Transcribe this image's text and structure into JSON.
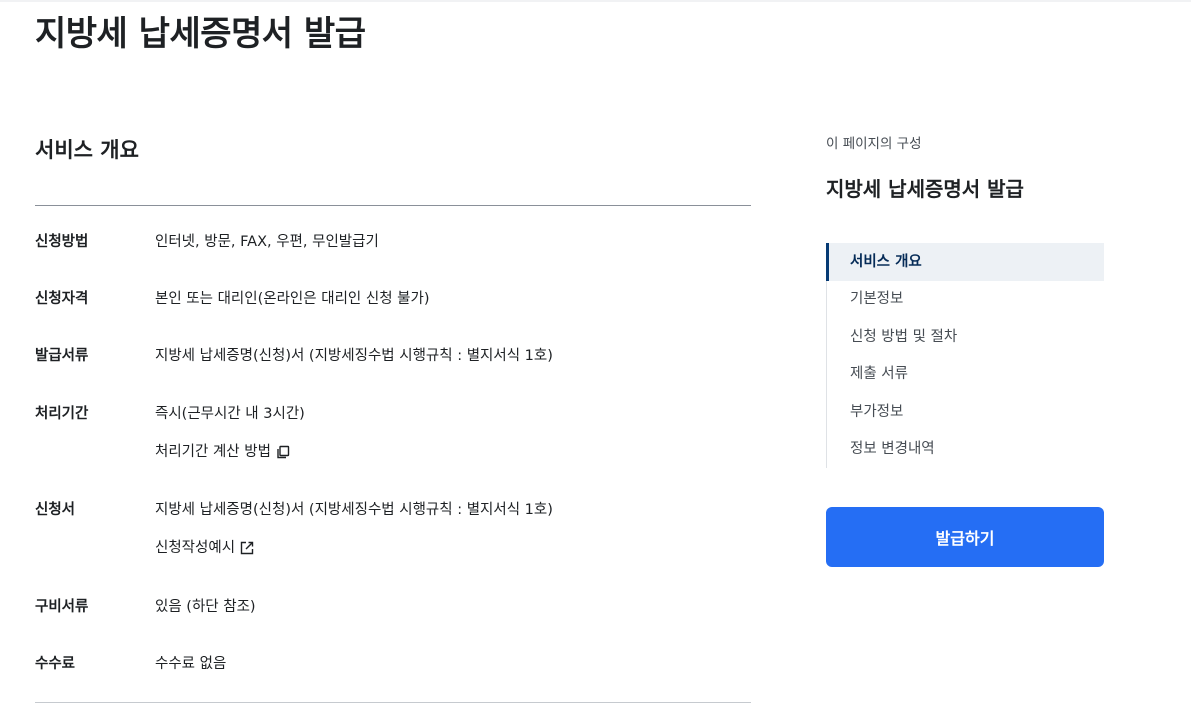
{
  "page": {
    "title": "지방세 납세증명서 발급"
  },
  "service_overview": {
    "title": "서비스 개요",
    "rows": [
      {
        "label": "신청방법",
        "lines": [
          "인터넷, 방문, FAX, 우편, 무인발급기"
        ]
      },
      {
        "label": "신청자격",
        "lines": [
          "본인 또는 대리인(온라인은 대리인 신청 불가)"
        ]
      },
      {
        "label": "발급서류",
        "lines": [
          "지방세 납세증명(신청)서 (지방세징수법 시행규칙 : 별지서식 1호)"
        ]
      },
      {
        "label": "처리기간",
        "lines": [
          "즉시(근무시간 내 3시간)"
        ],
        "link": {
          "text": "처리기간 계산 방법",
          "icon": "copy-icon"
        }
      },
      {
        "label": "신청서",
        "lines": [
          "지방세 납세증명(신청)서 (지방세징수법 시행규칙 : 별지서식 1호)"
        ],
        "link": {
          "text": "신청작성예시",
          "icon": "external-link-icon"
        }
      },
      {
        "label": "구비서류",
        "lines": [
          "있음 (하단 참조)"
        ]
      },
      {
        "label": "수수료",
        "lines": [
          "수수료 없음"
        ]
      }
    ]
  },
  "aside": {
    "caption": "이 페이지의 구성",
    "title": "지방세 납세증명서 발급",
    "toc": [
      {
        "label": "서비스 개요",
        "active": true
      },
      {
        "label": "기본정보",
        "active": false
      },
      {
        "label": "신청 방법 및 절차",
        "active": false
      },
      {
        "label": "제출 서류",
        "active": false
      },
      {
        "label": "부가정보",
        "active": false
      },
      {
        "label": "정보 변경내역",
        "active": false
      }
    ],
    "button_label": "발급하기"
  },
  "colors": {
    "primary_button": "#256ef4",
    "active_toc_bar": "#063a74",
    "active_toc_bg": "#edf1f5"
  }
}
